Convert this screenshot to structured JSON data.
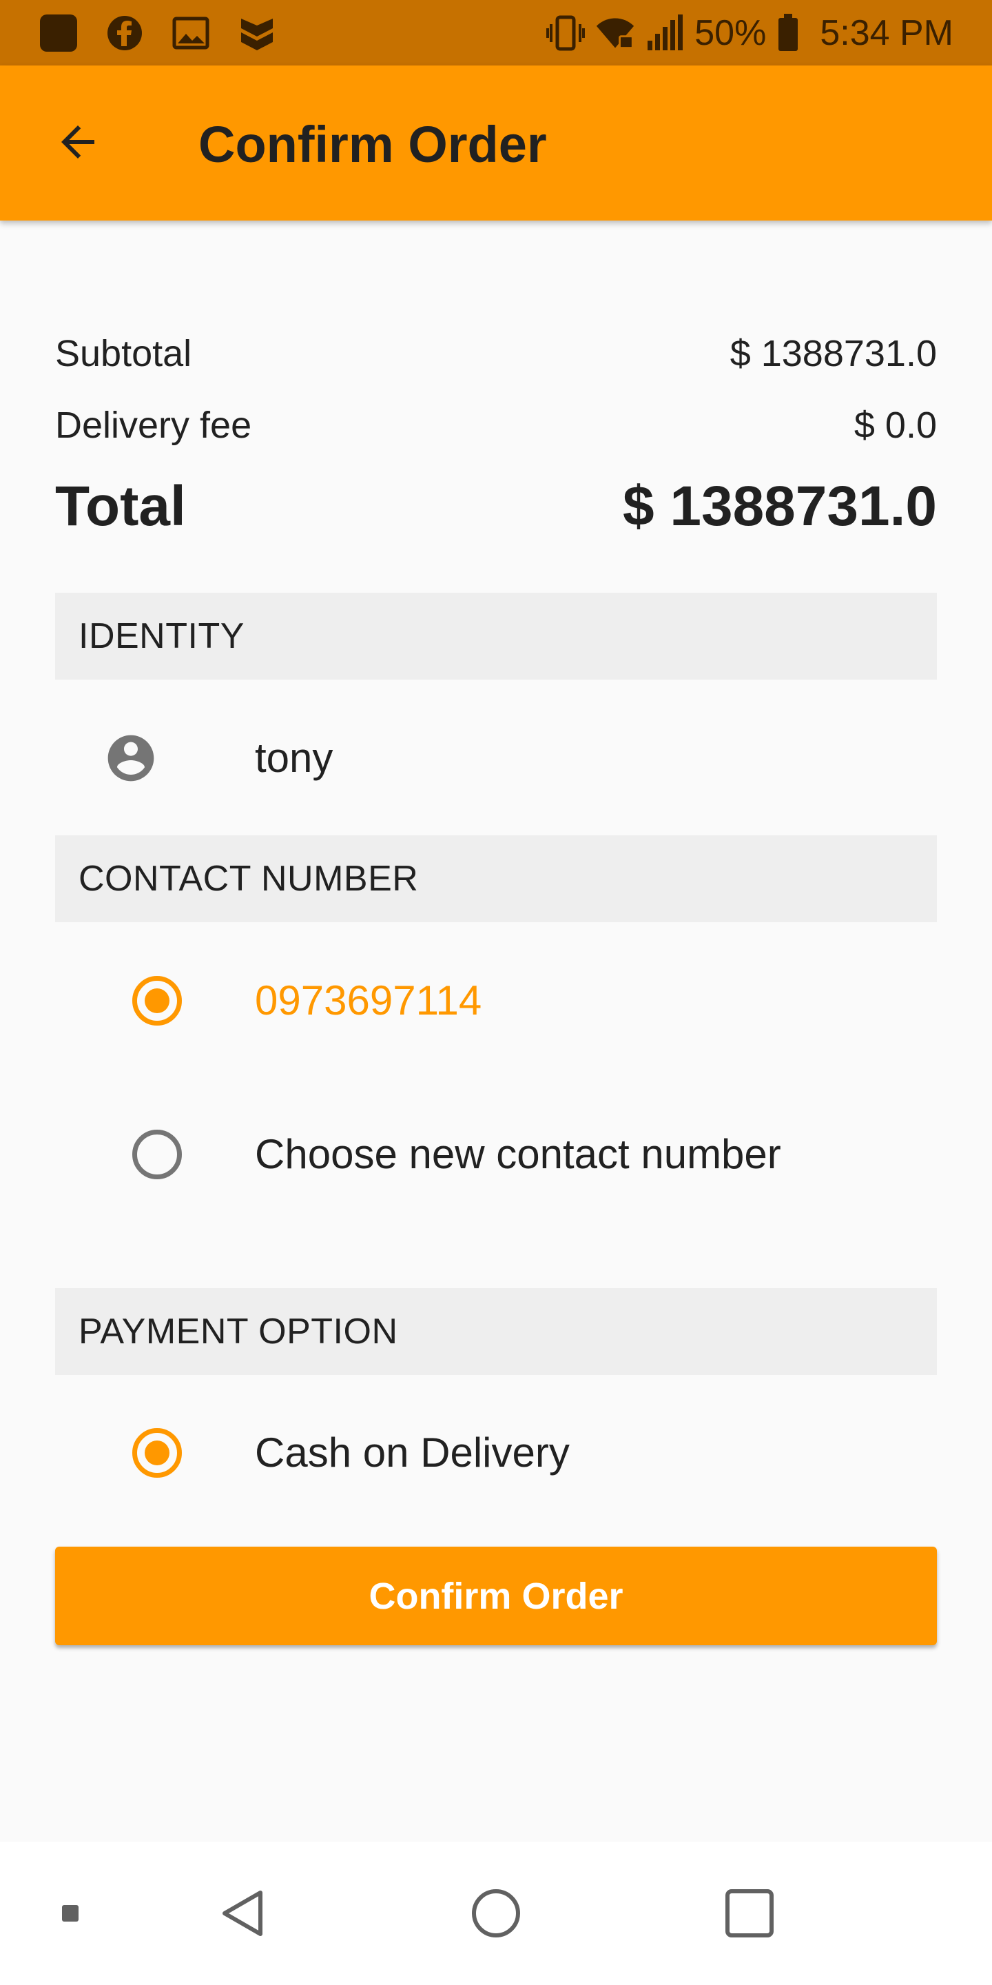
{
  "status_bar": {
    "battery": "50%",
    "time": "5:34 PM",
    "left_icons": [
      "app-square-icon",
      "facebook-icon",
      "image-icon",
      "shield-badge-icon"
    ],
    "right_icons": [
      "vibrate-icon",
      "wifi-locked-icon",
      "signal-icon",
      "battery-icon"
    ]
  },
  "app_bar": {
    "title": "Confirm Order",
    "back_icon": "arrow-back-icon",
    "color": "#ff9800"
  },
  "summary": {
    "subtotal_label": "Subtotal",
    "subtotal_value": "$ 1388731.0",
    "delivery_label": "Delivery fee",
    "delivery_value": "$ 0.0",
    "total_label": "Total",
    "total_value": "$ 1388731.0"
  },
  "identity": {
    "header": "IDENTITY",
    "name": "tony",
    "icon": "account-circle-icon"
  },
  "contact": {
    "header": "CONTACT NUMBER",
    "options": [
      {
        "label": "0973697114",
        "selected": true
      },
      {
        "label": "Choose new contact number",
        "selected": false
      }
    ]
  },
  "payment": {
    "header": "PAYMENT OPTION",
    "options": [
      {
        "label": "Cash on Delivery",
        "selected": true
      }
    ]
  },
  "confirm_button": {
    "label": "Confirm Order"
  },
  "nav_bar": {
    "icons": [
      "small-square-icon",
      "nav-back-icon",
      "nav-home-icon",
      "nav-recents-icon"
    ]
  },
  "colors": {
    "accent": "#ff9800",
    "status_bar": "#c67100",
    "section_bg": "#eeeeee",
    "background": "#fafafa"
  }
}
